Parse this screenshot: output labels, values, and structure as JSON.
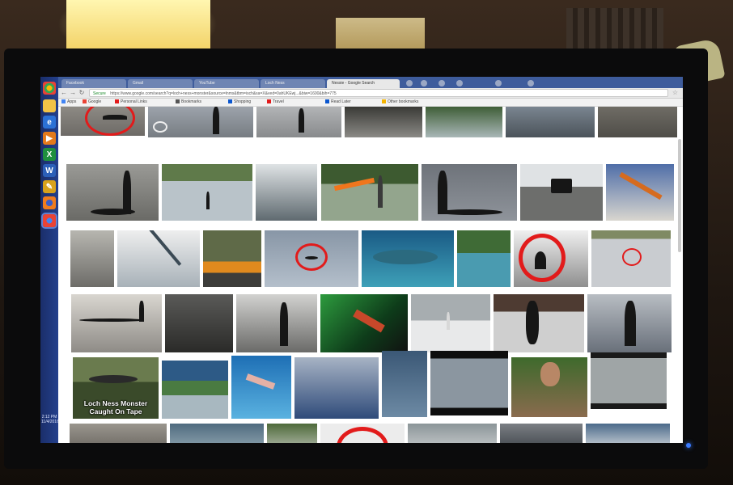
{
  "browser": {
    "tabs": [
      {
        "label": "Facebook"
      },
      {
        "label": "Gmail"
      },
      {
        "label": "YouTube"
      },
      {
        "label": "Loch Ness"
      },
      {
        "label": "Nessie - Google Search"
      }
    ],
    "address_bar": {
      "secure_label": "Secure",
      "url": "https://www.google.com/search?q=loch+ness+monster&source=lnms&tbm=isch&sa=X&ved=0ahUKEwj...&biw=1600&bih=775"
    },
    "bookmarks": [
      {
        "label": "Apps",
        "color": "#4285f4"
      },
      {
        "label": "Google",
        "color": "#ea4335"
      },
      {
        "label": "Personal Links",
        "color": "#e31b1b"
      },
      {
        "label": "Bookmarks",
        "color": "#555555"
      },
      {
        "label": "Shopping",
        "color": "#0b57d0"
      },
      {
        "label": "Travel",
        "color": "#e31b1b"
      },
      {
        "label": "Read Later",
        "color": "#0b57d0"
      },
      {
        "label": "Other bookmarks",
        "color": "#f4b400"
      }
    ]
  },
  "taskbar": {
    "icons": [
      {
        "name": "chrome-icon"
      },
      {
        "name": "folder-icon"
      },
      {
        "name": "internet-explorer-icon"
      },
      {
        "name": "media-player-icon"
      },
      {
        "name": "excel-icon"
      },
      {
        "name": "word-icon"
      },
      {
        "name": "paint-icon"
      },
      {
        "name": "firefox-icon"
      },
      {
        "name": "chrome-active-icon"
      }
    ],
    "clock": {
      "time": "2:12 PM",
      "date": "11/4/2016"
    }
  },
  "results": {
    "caption_thumbnail_text": "Loch Ness Monster Caught On Tape"
  },
  "colors": {
    "highlight_ring": "#e21b1b",
    "taskbar": "#1f3a80",
    "tabstrip": "#3e5c9c"
  }
}
